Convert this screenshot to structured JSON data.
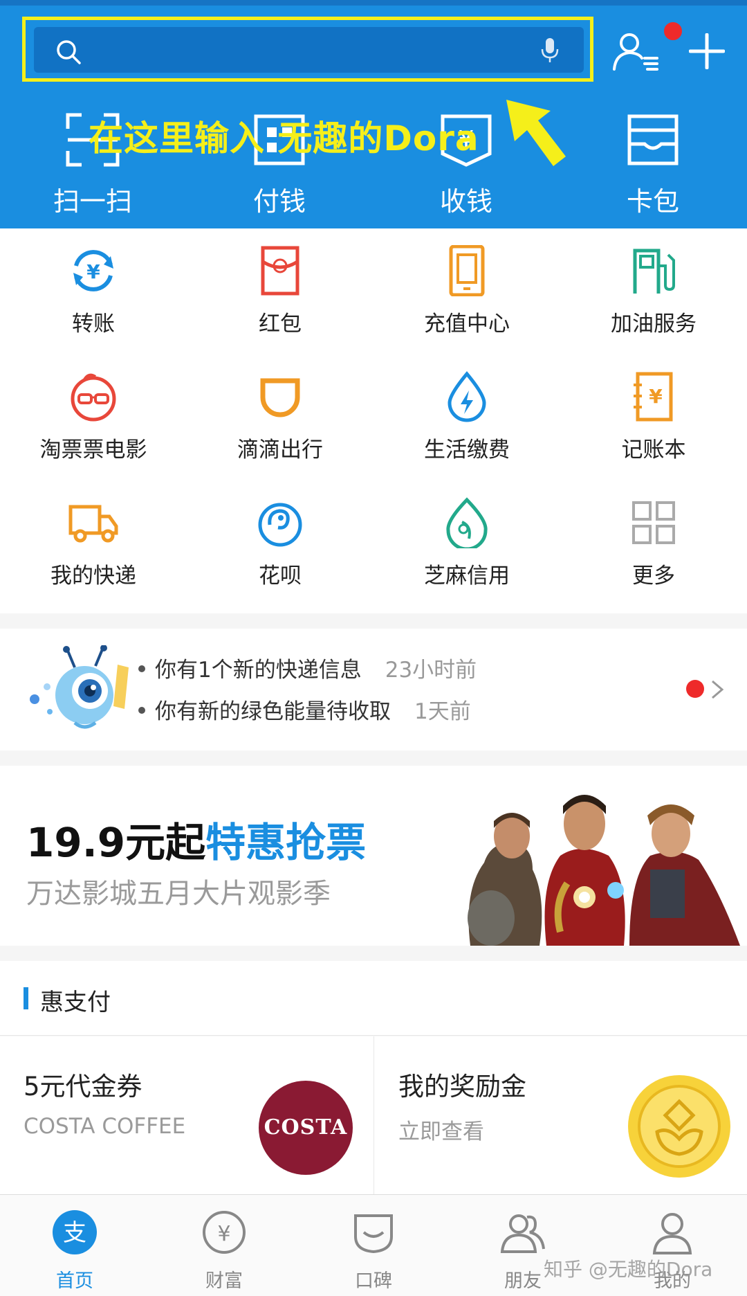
{
  "header": {
    "search_placeholder": "",
    "annotation": "在这里输入 无趣的Dora",
    "actions": [
      {
        "label": "扫一扫",
        "icon": "scan-icon"
      },
      {
        "label": "付钱",
        "icon": "pay-icon"
      },
      {
        "label": "收钱",
        "icon": "collect-icon"
      },
      {
        "label": "卡包",
        "icon": "card-wallet-icon"
      }
    ]
  },
  "services": [
    {
      "label": "转账",
      "icon": "transfer-icon"
    },
    {
      "label": "红包",
      "icon": "red-envelope-icon"
    },
    {
      "label": "充值中心",
      "icon": "phone-topup-icon"
    },
    {
      "label": "加油服务",
      "icon": "fuel-icon"
    },
    {
      "label": "淘票票电影",
      "icon": "movie-ticket-icon"
    },
    {
      "label": "滴滴出行",
      "icon": "didi-icon"
    },
    {
      "label": "生活缴费",
      "icon": "utility-icon"
    },
    {
      "label": "记账本",
      "icon": "ledger-icon"
    },
    {
      "label": "我的快递",
      "icon": "delivery-truck-icon"
    },
    {
      "label": "花呗",
      "icon": "huabei-icon"
    },
    {
      "label": "芝麻信用",
      "icon": "sesame-credit-icon"
    },
    {
      "label": "更多",
      "icon": "more-grid-icon"
    }
  ],
  "notifications": [
    {
      "text": "你有1个新的快递信息",
      "time": "23小时前"
    },
    {
      "text": "你有新的绿色能量待收取",
      "time": "1天前"
    }
  ],
  "banner": {
    "price": "19.9元起",
    "highlight": "特惠抢票",
    "subtitle": "万达影城五月大片观影季"
  },
  "section": {
    "title": "惠支付"
  },
  "cards": [
    {
      "title": "5元代金券",
      "subtitle": "COSTA COFFEE",
      "logo_text": "COSTA"
    },
    {
      "title": "我的奖励金",
      "subtitle": "立即查看"
    }
  ],
  "bottom_nav": [
    {
      "label": "首页",
      "icon": "home-alipay-icon",
      "active": true
    },
    {
      "label": "财富",
      "icon": "wealth-icon",
      "active": false
    },
    {
      "label": "口碑",
      "icon": "koubei-icon",
      "active": false
    },
    {
      "label": "朋友",
      "icon": "friends-icon",
      "active": false
    },
    {
      "label": "我的",
      "icon": "profile-icon",
      "active": false
    }
  ],
  "watermark": "知乎 @无趣的Dora",
  "colors": {
    "brand_blue": "#1a8ee0",
    "annotation_yellow": "#f5ef1a",
    "alert_red": "#ee2a2a"
  }
}
